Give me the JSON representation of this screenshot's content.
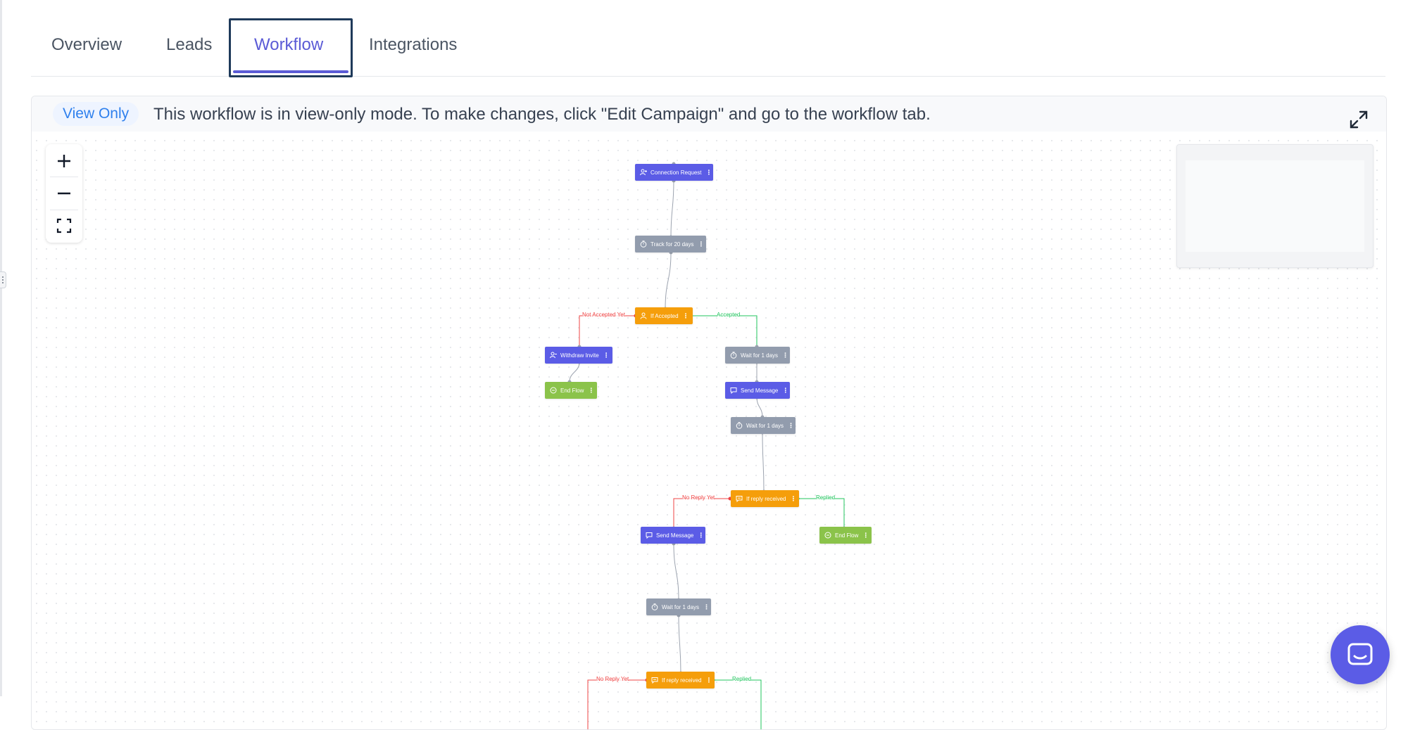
{
  "tabs": [
    {
      "label": "Overview"
    },
    {
      "label": "Leads"
    },
    {
      "label": "Workflow",
      "active": true
    },
    {
      "label": "Integrations"
    }
  ],
  "notice": {
    "badge": "View Only",
    "text": "This workflow is in view-only mode. To make changes, click \"Edit Campaign\" and go to the workflow tab."
  },
  "workflow": {
    "nodes": {
      "connection_request": "Connection Request",
      "track": "Track for 20 days",
      "if_accepted": "If Accepted",
      "withdraw": "Withdraw Invite",
      "end_flow_1": "End Flow",
      "wait_1": "Wait for 1 days",
      "send_message_1": "Send Message",
      "wait_2": "Wait for 1 days",
      "if_reply_1": "If reply received",
      "send_message_2": "Send Message",
      "end_flow_2": "End Flow",
      "wait_3": "Wait for 1 days",
      "if_reply_2": "If reply received"
    },
    "edges": {
      "not_accepted": "Not Accepted Yet",
      "accepted": "Accepted",
      "no_reply_1": "No Reply Yet",
      "replied_1": "Replied",
      "no_reply_2": "No Reply Yet",
      "replied_2": "Replied"
    }
  },
  "colors": {
    "accent": "#5b5bd6",
    "action_node": "#5b5ce6",
    "wait_node": "#929cad",
    "condition_node": "#f59e0b",
    "end_node": "#8bc34a",
    "negative_edge": "#ef4444",
    "positive_edge": "#22c55e"
  }
}
